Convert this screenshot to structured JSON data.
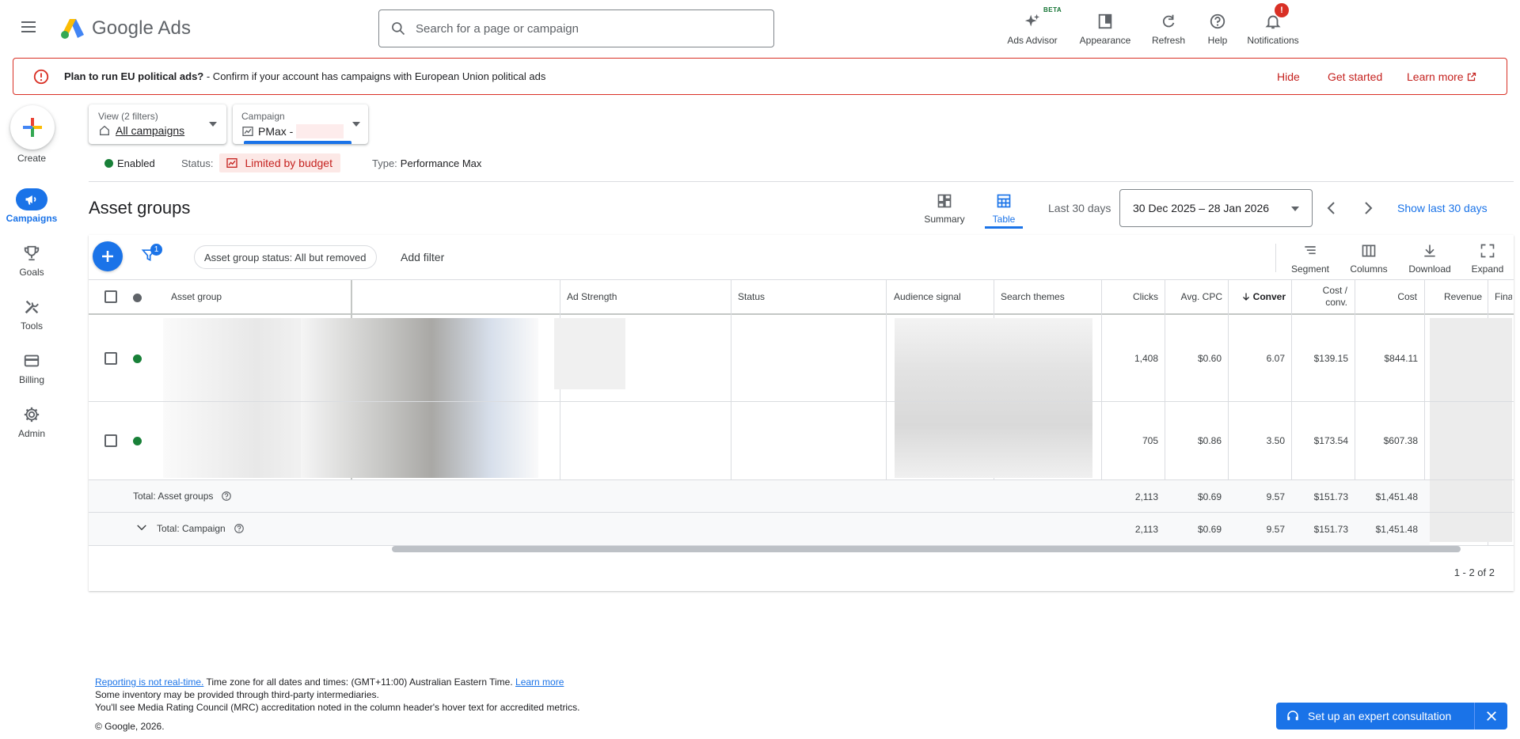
{
  "header": {
    "product_name": "Google Ads",
    "search_placeholder": "Search for a page or campaign",
    "actions": {
      "ads_advisor": "Ads Advisor",
      "beta": "BETA",
      "appearance": "Appearance",
      "refresh": "Refresh",
      "help": "Help",
      "notifications": "Notifications",
      "notification_badge": "!"
    }
  },
  "alert": {
    "title": "Plan to run EU political ads?",
    "message": " - Confirm if your account has campaigns with European Union political ads",
    "hide": "Hide",
    "get_started": "Get started",
    "learn_more": "Learn more"
  },
  "sidebar": {
    "create": "Create",
    "items": [
      {
        "label": "Campaigns",
        "icon": "megaphone-icon",
        "active": true
      },
      {
        "label": "Goals",
        "icon": "trophy-icon"
      },
      {
        "label": "Tools",
        "icon": "tools-icon"
      },
      {
        "label": "Billing",
        "icon": "credit-card-icon"
      },
      {
        "label": "Admin",
        "icon": "gear-icon"
      }
    ]
  },
  "selectors": {
    "view_label": "View (2 filters)",
    "view_value": "All campaigns",
    "campaign_label": "Campaign",
    "campaign_value": "PMax -"
  },
  "campaign_status": {
    "enabled": "Enabled",
    "status_label": "Status:",
    "status_value": "Limited by budget",
    "type_label": "Type:",
    "type_value": "Performance Max"
  },
  "page": {
    "title": "Asset groups",
    "view_summary": "Summary",
    "view_table": "Table",
    "date_label": "Last 30 days",
    "date_range": "30 Dec 2025 – 28 Jan 2026",
    "show_last": "Show last 30 days"
  },
  "toolbar": {
    "filter_count": "1",
    "filter_chip": "Asset group status: All but removed",
    "add_filter": "Add filter",
    "segment": "Segment",
    "columns": "Columns",
    "download": "Download",
    "expand": "Expand"
  },
  "table": {
    "columns": {
      "asset_group": "Asset group",
      "ad_strength": "Ad Strength",
      "status": "Status",
      "audience_signal": "Audience signal",
      "search_themes": "Search themes",
      "clicks": "Clicks",
      "avg_cpc": "Avg. CPC",
      "conversions": "Conver",
      "cost_per_conv_1": "Cost /",
      "cost_per_conv_2": "conv.",
      "cost": "Cost",
      "revenue": "Revenue",
      "final": "Final"
    },
    "rows": [
      {
        "clicks": "1,408",
        "avg_cpc": "$0.60",
        "conversions": "6.07",
        "cost_per_conv": "$139.15",
        "cost": "$844.11"
      },
      {
        "clicks": "705",
        "avg_cpc": "$0.86",
        "conversions": "3.50",
        "cost_per_conv": "$173.54",
        "cost": "$607.38"
      }
    ],
    "totals": [
      {
        "label": "Total: Asset groups",
        "clicks": "2,113",
        "avg_cpc": "$0.69",
        "conversions": "9.57",
        "cost_per_conv": "$151.73",
        "cost": "$1,451.48"
      },
      {
        "label": "Total: Campaign",
        "clicks": "2,113",
        "avg_cpc": "$0.69",
        "conversions": "9.57",
        "cost_per_conv": "$151.73",
        "cost": "$1,451.48"
      }
    ],
    "pagination": "1 - 2 of 2"
  },
  "footer": {
    "reporting_link": "Reporting is not real-time.",
    "timezone_text": " Time zone for all dates and times: (GMT+11:00) Australian Eastern Time. ",
    "learn_more": "Learn more",
    "inventory": "Some inventory may be provided through third-party intermediaries.",
    "mrc": "You'll see Media Rating Council (MRC) accreditation noted in the column header's hover text for accredited metrics.",
    "copyright": "© Google, 2026."
  },
  "consult": {
    "label": "Set up an expert consultation"
  },
  "colors": {
    "primary": "#1a73e8",
    "error": "#d93025",
    "success": "#188038"
  }
}
